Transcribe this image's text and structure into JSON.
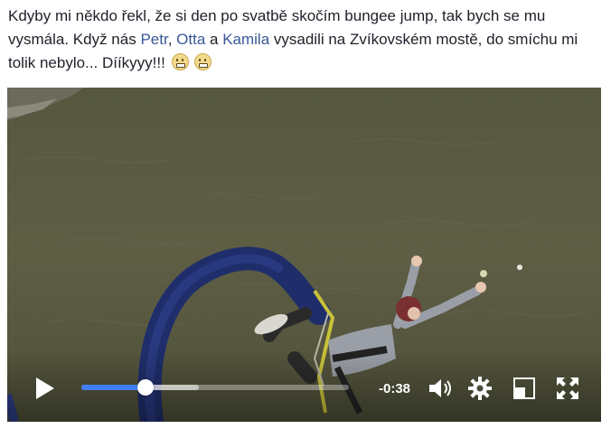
{
  "post": {
    "text_1": "Kdyby mi někdo řekl, že si den po svatbě skočím bungee jump, tak bych se mu vysmála. Když nás ",
    "mention_1": "Petr",
    "sep_1": ", ",
    "mention_2": "Otta",
    "sep_2": " a ",
    "mention_3": "Kamila",
    "text_2": " vysadili na Zvíkovském mostě, do smíchu mi tolik nebylo... Dííkyyy!!!",
    "emojis": [
      "grimacing-emoji",
      "grimacing-emoji"
    ]
  },
  "video": {
    "progress_fraction": 0.24,
    "buffered_fraction": 0.44,
    "time_remaining": "-0:38",
    "accent_color": "#4080ff",
    "controls": [
      "play-icon",
      "volume-icon",
      "settings-icon",
      "pip-icon",
      "fullscreen-icon"
    ]
  }
}
